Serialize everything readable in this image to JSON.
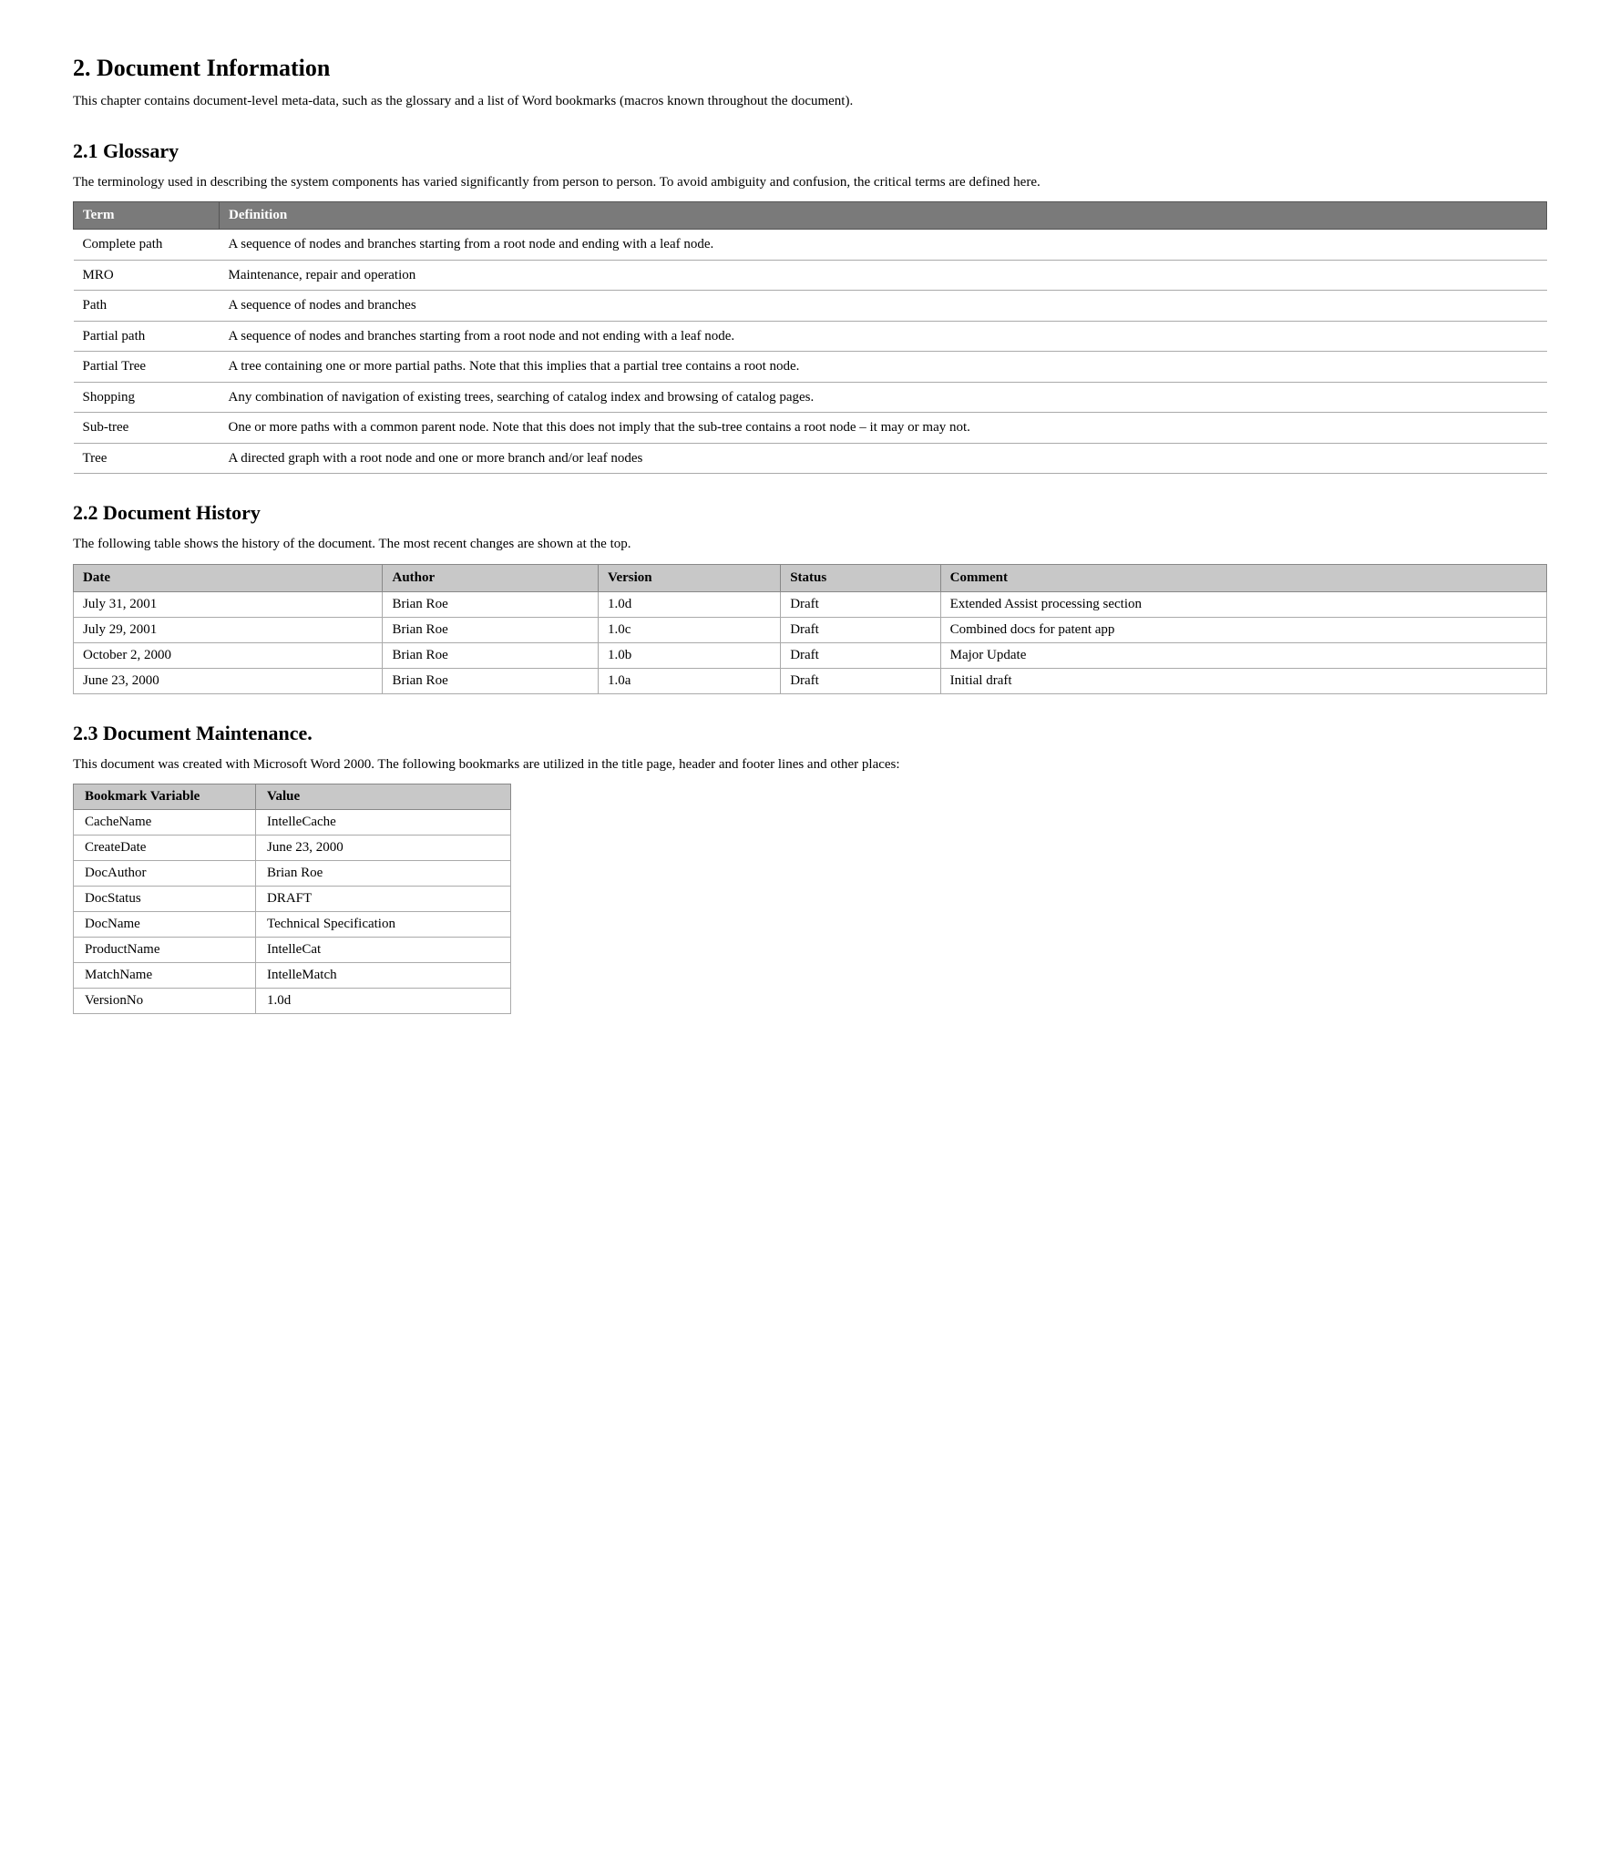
{
  "section2": {
    "title": "2.   Document Information",
    "intro": "This chapter contains document-level meta-data, such as the glossary and a list of Word bookmarks (macros known throughout the document)."
  },
  "section21": {
    "title": "2.1   Glossary",
    "intro": "The terminology used in describing the system components has varied significantly from person to person.  To avoid ambiguity and confusion, the critical terms are defined here.",
    "table_headers": [
      "Term",
      "Definition"
    ],
    "rows": [
      {
        "term": "Complete path",
        "definition": "A sequence of nodes and branches starting from a root node and ending with a leaf node."
      },
      {
        "term": "MRO",
        "definition": "Maintenance, repair and operation"
      },
      {
        "term": "Path",
        "definition": "A sequence of nodes and branches"
      },
      {
        "term": "Partial path",
        "definition": "A sequence of nodes and branches starting from a root node and not ending with a leaf node."
      },
      {
        "term": "Partial Tree",
        "definition": "A tree containing one or more partial paths.  Note that this implies that a partial tree contains a root node."
      },
      {
        "term": "Shopping",
        "definition": "Any combination of navigation of existing trees, searching of catalog index and browsing of catalog pages."
      },
      {
        "term": "Sub-tree",
        "definition": "One or more paths with a common parent node.  Note that this does not imply that the sub-tree contains a root node – it may or may not."
      },
      {
        "term": "Tree",
        "definition": "A directed graph with a root node and one or more branch and/or leaf nodes"
      }
    ]
  },
  "section22": {
    "title": "2.2   Document History",
    "intro": "The following table shows the history of the document.  The most recent changes are shown at the top.",
    "table_headers": [
      "Date",
      "Author",
      "Version",
      "Status",
      "Comment"
    ],
    "rows": [
      {
        "date": "July 31, 2001",
        "author": "Brian Roe",
        "version": "1.0d",
        "status": "Draft",
        "comment": "Extended Assist processing section"
      },
      {
        "date": "July 29, 2001",
        "author": "Brian Roe",
        "version": "1.0c",
        "status": "Draft",
        "comment": "Combined docs for patent app"
      },
      {
        "date": "October 2, 2000",
        "author": "Brian Roe",
        "version": "1.0b",
        "status": "Draft",
        "comment": "Major Update"
      },
      {
        "date": "June 23, 2000",
        "author": "Brian Roe",
        "version": "1.0a",
        "status": "Draft",
        "comment": "Initial draft"
      }
    ]
  },
  "section23": {
    "title": "2.3   Document Maintenance.",
    "intro": "This document was created with Microsoft Word 2000. The following bookmarks are utilized in the title page, header and footer lines and other places:",
    "table_headers": [
      "Bookmark Variable",
      "Value"
    ],
    "rows": [
      {
        "variable": "CacheName",
        "value": "IntelleCache"
      },
      {
        "variable": "CreateDate",
        "value": "June 23, 2000"
      },
      {
        "variable": "DocAuthor",
        "value": "Brian Roe"
      },
      {
        "variable": "DocStatus",
        "value": "DRAFT"
      },
      {
        "variable": "DocName",
        "value": "Technical Specification"
      },
      {
        "variable": "ProductName",
        "value": "IntelleCat"
      },
      {
        "variable": "MatchName",
        "value": "IntelleMatch"
      },
      {
        "variable": "VersionNo",
        "value": "1.0d"
      }
    ]
  }
}
